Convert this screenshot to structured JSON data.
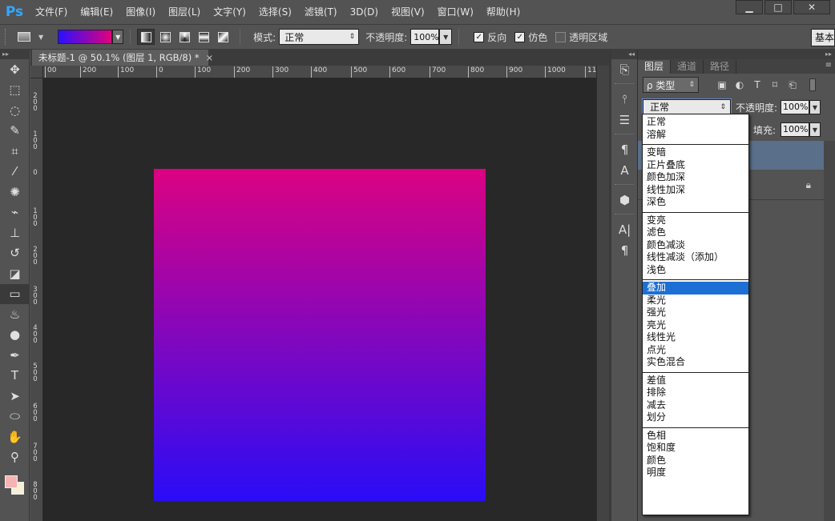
{
  "app": {
    "logo": "Ps",
    "menu": [
      "文件(F)",
      "编辑(E)",
      "图像(I)",
      "图层(L)",
      "文字(Y)",
      "选择(S)",
      "滤镜(T)",
      "3D(D)",
      "视图(V)",
      "窗口(W)",
      "帮助(H)"
    ],
    "window_buttons": {
      "minimize": "▁",
      "maximize": "□",
      "close": "✕"
    }
  },
  "options_bar": {
    "gradient_colors": [
      "#2a10ff",
      "#e0007c"
    ],
    "mode_label": "模式:",
    "mode_value": "正常",
    "opacity_label": "不透明度:",
    "opacity_value": "100%",
    "reverse_label": "反向",
    "reverse_checked": true,
    "dither_label": "仿色",
    "dither_checked": true,
    "transparency_label": "透明区域",
    "transparency_checked": false,
    "workspace_label": "基本"
  },
  "toolbar": {
    "tools": [
      "move-icon",
      "marquee-icon",
      "lasso-icon",
      "quick-select-icon",
      "crop-icon",
      "eyedropper-icon",
      "spot-heal-icon",
      "brush-icon",
      "stamp-icon",
      "history-brush-icon",
      "eraser-icon",
      "gradient-icon",
      "blur-icon",
      "dodge-icon",
      "pen-icon",
      "type-icon",
      "path-select-icon",
      "ellipse-icon",
      "hand-icon",
      "zoom-icon"
    ],
    "active_tool": "gradient-icon",
    "foreground_color": "#f6b3b3",
    "background_color": "#f5efd6"
  },
  "document": {
    "tab_title": "未标题-1 @ 50.1% (图层 1, RGB/8) *",
    "tab_close": "×",
    "ruler_h": [
      "00",
      "200",
      "100",
      "0",
      "100",
      "200",
      "300",
      "400",
      "500",
      "600",
      "700",
      "800",
      "900",
      "1000",
      "11"
    ],
    "ruler_v": [
      "2 0 0",
      "1 0 0",
      "0",
      "1 0 0",
      "2 0 0",
      "3 0 0",
      "4 0 0",
      "5 0 0",
      "6 0 0",
      "7 0 0",
      "8 0 0"
    ],
    "gradient_top": "#dc0282",
    "gradient_bottom": "#2a0cf7"
  },
  "layers_panel": {
    "tabs": [
      "图层",
      "通道",
      "路径"
    ],
    "active_tab": "图层",
    "filter_label": "ρ 类型",
    "blend_value": "正常",
    "opacity_label": "不透明度:",
    "opacity_value": "100%",
    "fill_label": "填充:",
    "fill_value": "100%"
  },
  "blend_modes": {
    "groups": [
      [
        "正常",
        "溶解"
      ],
      [
        "变暗",
        "正片叠底",
        "颜色加深",
        "线性加深",
        "深色"
      ],
      [
        "变亮",
        "滤色",
        "颜色减淡",
        "线性减淡（添加）",
        "浅色"
      ],
      [
        "叠加",
        "柔光",
        "强光",
        "亮光",
        "线性光",
        "点光",
        "实色混合"
      ],
      [
        "差值",
        "排除",
        "减去",
        "划分"
      ],
      [
        "色相",
        "饱和度",
        "颜色",
        "明度"
      ]
    ],
    "highlighted": "叠加"
  }
}
